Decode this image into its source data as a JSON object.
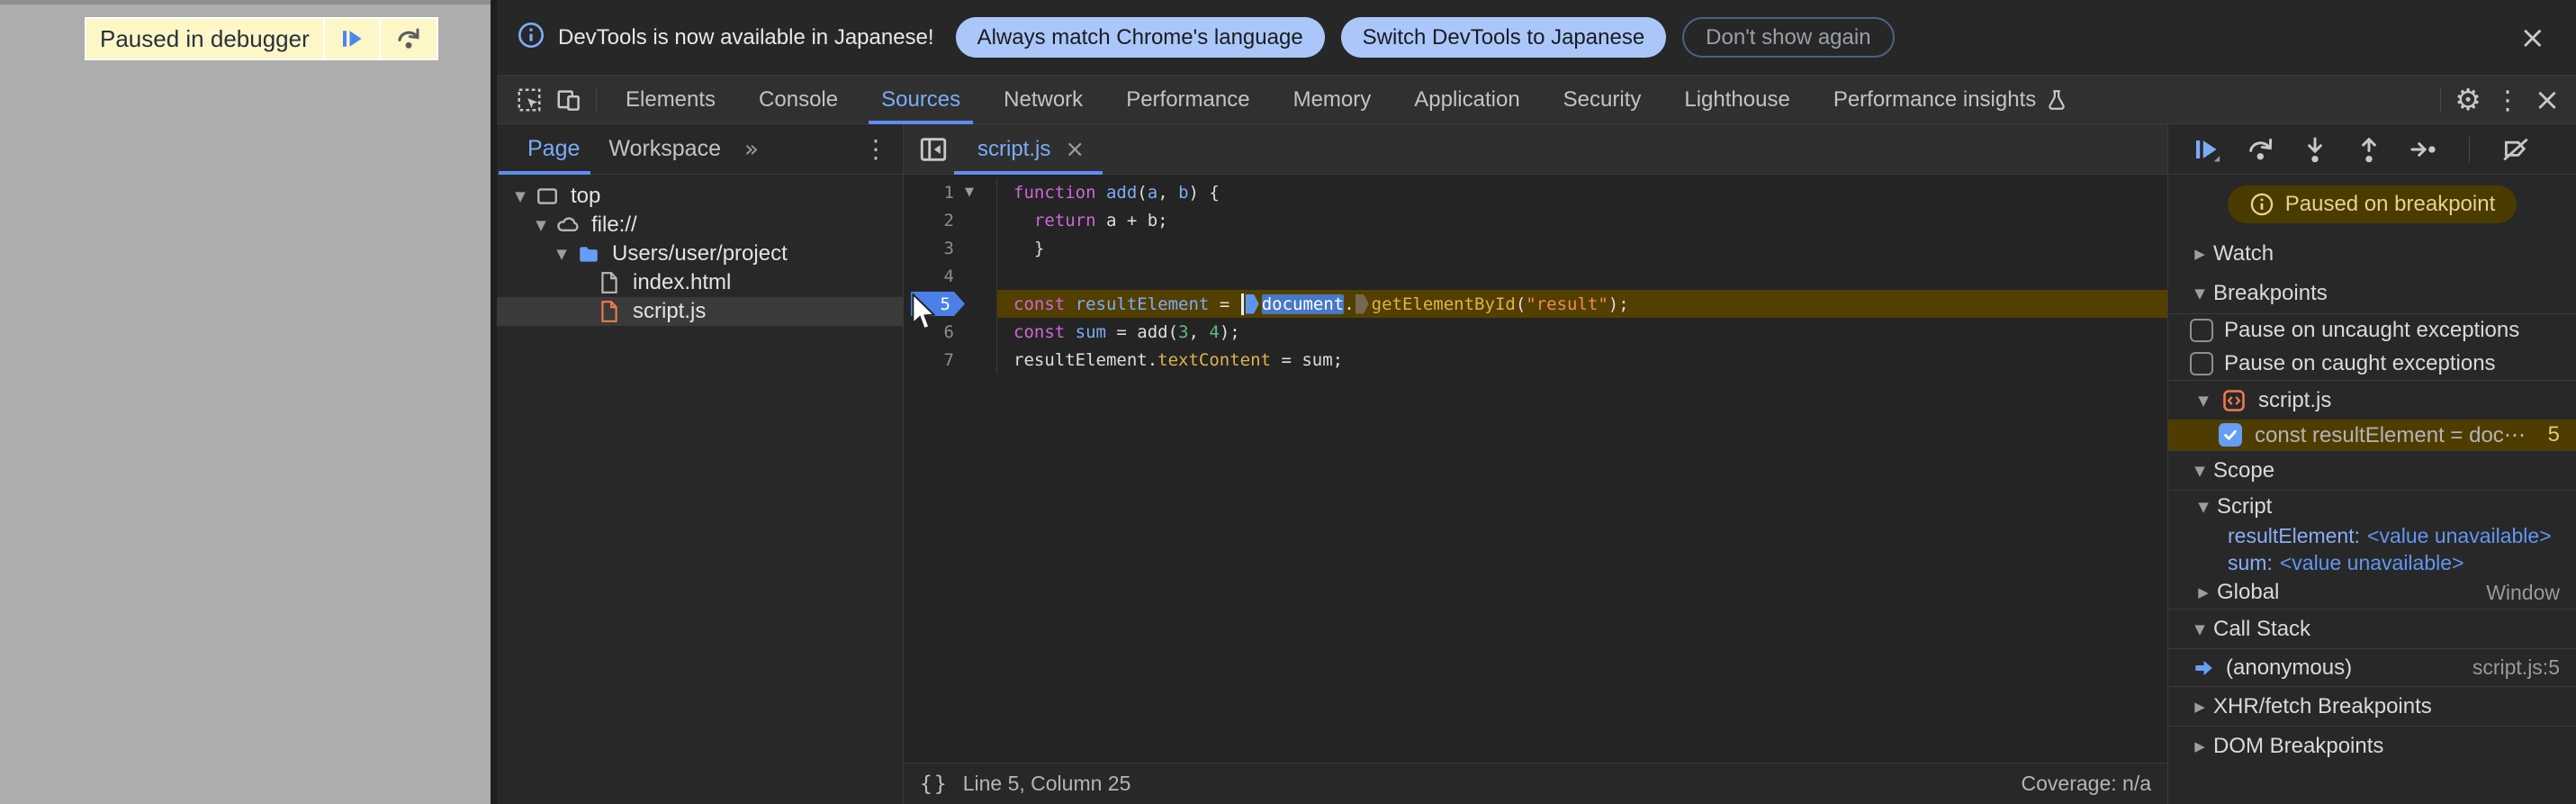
{
  "page_overlay": {
    "paused_label": "Paused in debugger"
  },
  "infobar": {
    "message": "DevTools is now available in Japanese!",
    "btn_match": "Always match Chrome's language",
    "btn_switch": "Switch DevTools to Japanese",
    "btn_dismiss": "Don't show again",
    "close": "×"
  },
  "tabbar": {
    "tabs": [
      {
        "id": "elements",
        "label": "Elements"
      },
      {
        "id": "console",
        "label": "Console"
      },
      {
        "id": "sources",
        "label": "Sources",
        "active": true
      },
      {
        "id": "network",
        "label": "Network"
      },
      {
        "id": "performance",
        "label": "Performance"
      },
      {
        "id": "memory",
        "label": "Memory"
      },
      {
        "id": "application",
        "label": "Application"
      },
      {
        "id": "security",
        "label": "Security"
      },
      {
        "id": "lighthouse",
        "label": "Lighthouse"
      },
      {
        "id": "performance-insights",
        "label": "Performance insights",
        "flask": true
      }
    ],
    "gear": "⚙",
    "dots": "⋮",
    "close": "×"
  },
  "navigator": {
    "tab_page": "Page",
    "tab_workspace": "Workspace",
    "more": "»",
    "menu": "⋮",
    "tree": [
      {
        "label": "top",
        "icon": "frame",
        "depth": 0,
        "arrow": true
      },
      {
        "label": "file://",
        "icon": "cloud",
        "depth": 1,
        "arrow": true
      },
      {
        "label": "Users/user/project",
        "icon": "folder",
        "depth": 2,
        "arrow": true
      },
      {
        "label": "index.html",
        "icon": "file-html",
        "depth": 3,
        "arrow": false
      },
      {
        "label": "script.js",
        "icon": "file-js",
        "depth": 3,
        "arrow": false,
        "selected": true
      }
    ]
  },
  "editor": {
    "tab": "script.js",
    "tab_close": "×",
    "status_left": "Line 5, Column 25",
    "status_right": "Coverage: n/a",
    "braces_icon": "{}",
    "lines": [
      {
        "num": "1",
        "fold": true,
        "tokens": [
          [
            "kw",
            "function"
          ],
          [
            "pl",
            " "
          ],
          [
            "id",
            "add"
          ],
          [
            "pl",
            "("
          ],
          [
            "id",
            "a"
          ],
          [
            "pl",
            ", "
          ],
          [
            "id",
            "b"
          ],
          [
            "pl",
            ") {"
          ]
        ]
      },
      {
        "num": "2",
        "tokens": [
          [
            "pl",
            "  "
          ],
          [
            "kw",
            "return"
          ],
          [
            "pl",
            " a + b;"
          ]
        ]
      },
      {
        "num": "3",
        "tokens": [
          [
            "pl",
            "  }"
          ]
        ]
      },
      {
        "num": "4",
        "tokens": []
      },
      {
        "num": "5",
        "current": true,
        "tokens": [
          [
            "kw",
            "const"
          ],
          [
            "pl",
            " "
          ],
          [
            "id",
            "resultElement"
          ],
          [
            "pl",
            " = "
          ],
          [
            "caret",
            ""
          ],
          [
            "m1",
            ""
          ],
          [
            "sel",
            "document"
          ],
          [
            "pl",
            "."
          ],
          [
            "m2",
            ""
          ],
          [
            "prop",
            "getElementById"
          ],
          [
            "pl",
            "("
          ],
          [
            "str",
            "\"result\""
          ],
          [
            "pl",
            ");"
          ]
        ]
      },
      {
        "num": "6",
        "tokens": [
          [
            "kw",
            "const"
          ],
          [
            "pl",
            " "
          ],
          [
            "id",
            "sum"
          ],
          [
            "pl",
            " = add("
          ],
          [
            "num",
            "3"
          ],
          [
            "pl",
            ", "
          ],
          [
            "num",
            "4"
          ],
          [
            "pl",
            ");"
          ]
        ]
      },
      {
        "num": "7",
        "tokens": [
          [
            "pl",
            "resultElement."
          ],
          [
            "prop",
            "textContent"
          ],
          [
            "pl",
            " = sum;"
          ]
        ]
      }
    ]
  },
  "debugger": {
    "paused_message": "Paused on breakpoint",
    "rows": [
      {
        "type": "header",
        "label": "Watch",
        "arrow": "right"
      },
      {
        "type": "header",
        "label": "Breakpoints",
        "arrow": "down"
      },
      {
        "type": "checkbox",
        "label": "Pause on uncaught exceptions",
        "checked": false,
        "sep": true
      },
      {
        "type": "checkbox",
        "label": "Pause on caught exceptions",
        "checked": false
      },
      {
        "type": "group",
        "label": "script.js",
        "arrow": "down",
        "sep": true
      },
      {
        "type": "breakpoint",
        "label": "const resultElement = doc⋯",
        "line": "5",
        "checked": true
      },
      {
        "type": "header",
        "label": "Scope",
        "arrow": "down",
        "sep": true
      },
      {
        "type": "subheader",
        "label": "Script",
        "arrow": "down",
        "sep": true
      },
      {
        "type": "scopevar",
        "name": "resultElement:",
        "value": "<value unavailable>"
      },
      {
        "type": "scopevar",
        "name": "sum:",
        "value": "<value unavailable>"
      },
      {
        "type": "global",
        "label": "Global",
        "right": "Window",
        "arrow": "right"
      },
      {
        "type": "header",
        "label": "Call Stack",
        "arrow": "down",
        "sep": true
      },
      {
        "type": "frame",
        "label": "(anonymous)",
        "right": "script.js:5",
        "sep": true
      },
      {
        "type": "header",
        "label": "XHR/fetch Breakpoints",
        "arrow": "right",
        "sep": true
      },
      {
        "type": "header",
        "label": "DOM Breakpoints",
        "arrow": "right",
        "sep": true
      }
    ]
  },
  "colors": {
    "accent_blue": "#7cacf8",
    "pill_blue": "#abc7fa",
    "execution_line": "#533f00",
    "paused_pill_bg": "#4a3b00",
    "breakpoint_arrow": "#4a80e8",
    "folder_blue": "#669df6",
    "script_orange": "#ee7a50",
    "keyword": "#ce68d6",
    "property": "#dfb348",
    "string": "#f08a55",
    "number": "#63ba7d",
    "page_gray": "#adadad",
    "badge_yellow": "#fdf6c6"
  }
}
